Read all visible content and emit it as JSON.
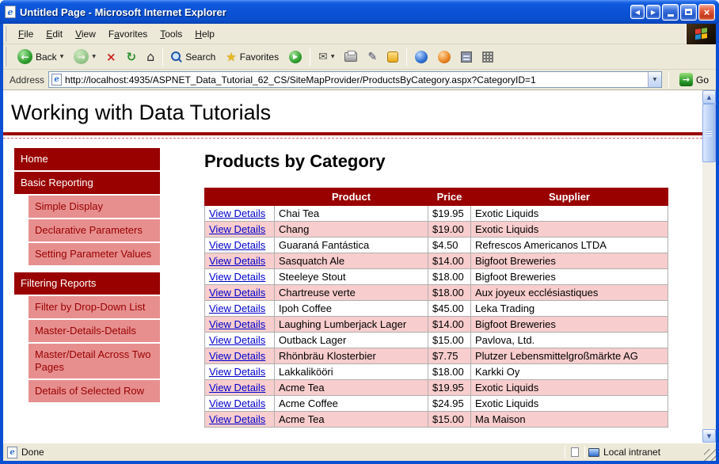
{
  "window": {
    "title": "Untitled Page - Microsoft Internet Explorer",
    "status": {
      "left": "Done",
      "zone_label": "Local intranet"
    }
  },
  "menu": {
    "items": [
      {
        "label": "File",
        "underline": 0
      },
      {
        "label": "Edit",
        "underline": 0
      },
      {
        "label": "View",
        "underline": 0
      },
      {
        "label": "Favorites",
        "underline": 1
      },
      {
        "label": "Tools",
        "underline": 0
      },
      {
        "label": "Help",
        "underline": 0
      }
    ]
  },
  "toolbar": {
    "back_label": "Back",
    "search_label": "Search",
    "favorites_label": "Favorites"
  },
  "address": {
    "label": "Address",
    "url": "http://localhost:4935/ASPNET_Data_Tutorial_62_CS/SiteMapProvider/ProductsByCategory.aspx?CategoryID=1",
    "go_label": "Go"
  },
  "page": {
    "site_title": "Working with Data Tutorials",
    "heading": "Products by Category",
    "nav_items": [
      {
        "label": "Home",
        "level": 0,
        "section_gap": false
      },
      {
        "label": "Basic Reporting",
        "level": 0,
        "section_gap": false
      },
      {
        "label": "Simple Display",
        "level": 1,
        "section_gap": false
      },
      {
        "label": "Declarative Parameters",
        "level": 1,
        "section_gap": false
      },
      {
        "label": "Setting Parameter Values",
        "level": 1,
        "section_gap": false
      },
      {
        "label": "Filtering Reports",
        "level": 0,
        "section_gap": true
      },
      {
        "label": "Filter by Drop-Down List",
        "level": 1,
        "section_gap": false
      },
      {
        "label": "Master-Details-Details",
        "level": 1,
        "section_gap": false
      },
      {
        "label": "Master/Detail Across Two Pages",
        "level": 1,
        "section_gap": false
      },
      {
        "label": "Details of Selected Row",
        "level": 1,
        "section_gap": false
      }
    ],
    "products_table": {
      "headers": [
        "",
        "Product",
        "Price",
        "Supplier"
      ],
      "details_link_label": "View Details",
      "rows": [
        {
          "product": "Chai Tea",
          "price": "$19.95",
          "supplier": "Exotic Liquids"
        },
        {
          "product": "Chang",
          "price": "$19.00",
          "supplier": "Exotic Liquids"
        },
        {
          "product": "Guaraná Fantástica",
          "price": "$4.50",
          "supplier": "Refrescos Americanos LTDA"
        },
        {
          "product": "Sasquatch Ale",
          "price": "$14.00",
          "supplier": "Bigfoot Breweries"
        },
        {
          "product": "Steeleye Stout",
          "price": "$18.00",
          "supplier": "Bigfoot Breweries"
        },
        {
          "product": "Chartreuse verte",
          "price": "$18.00",
          "supplier": "Aux joyeux ecclésiastiques"
        },
        {
          "product": "Ipoh Coffee",
          "price": "$45.00",
          "supplier": "Leka Trading"
        },
        {
          "product": "Laughing Lumberjack Lager",
          "price": "$14.00",
          "supplier": "Bigfoot Breweries"
        },
        {
          "product": "Outback Lager",
          "price": "$15.00",
          "supplier": "Pavlova, Ltd."
        },
        {
          "product": "Rhönbräu Klosterbier",
          "price": "$7.75",
          "supplier": "Plutzer Lebensmittelgroßmärkte AG"
        },
        {
          "product": "Lakkalikööri",
          "price": "$18.00",
          "supplier": "Karkki Oy"
        },
        {
          "product": "Acme Tea",
          "price": "$19.95",
          "supplier": "Exotic Liquids"
        },
        {
          "product": "Acme Coffee",
          "price": "$24.95",
          "supplier": "Exotic Liquids"
        },
        {
          "product": "Acme Tea",
          "price": "$15.00",
          "supplier": "Ma Maison"
        }
      ]
    }
  },
  "colors": {
    "accent_dark_red": "#990000",
    "nav_sub_bg": "#e78f8f",
    "alt_row_pink": "#f8cdcd",
    "link_blue": "#0000cc",
    "titlebar_blue": "#0a51d4",
    "chrome_beige": "#ece9d8"
  }
}
